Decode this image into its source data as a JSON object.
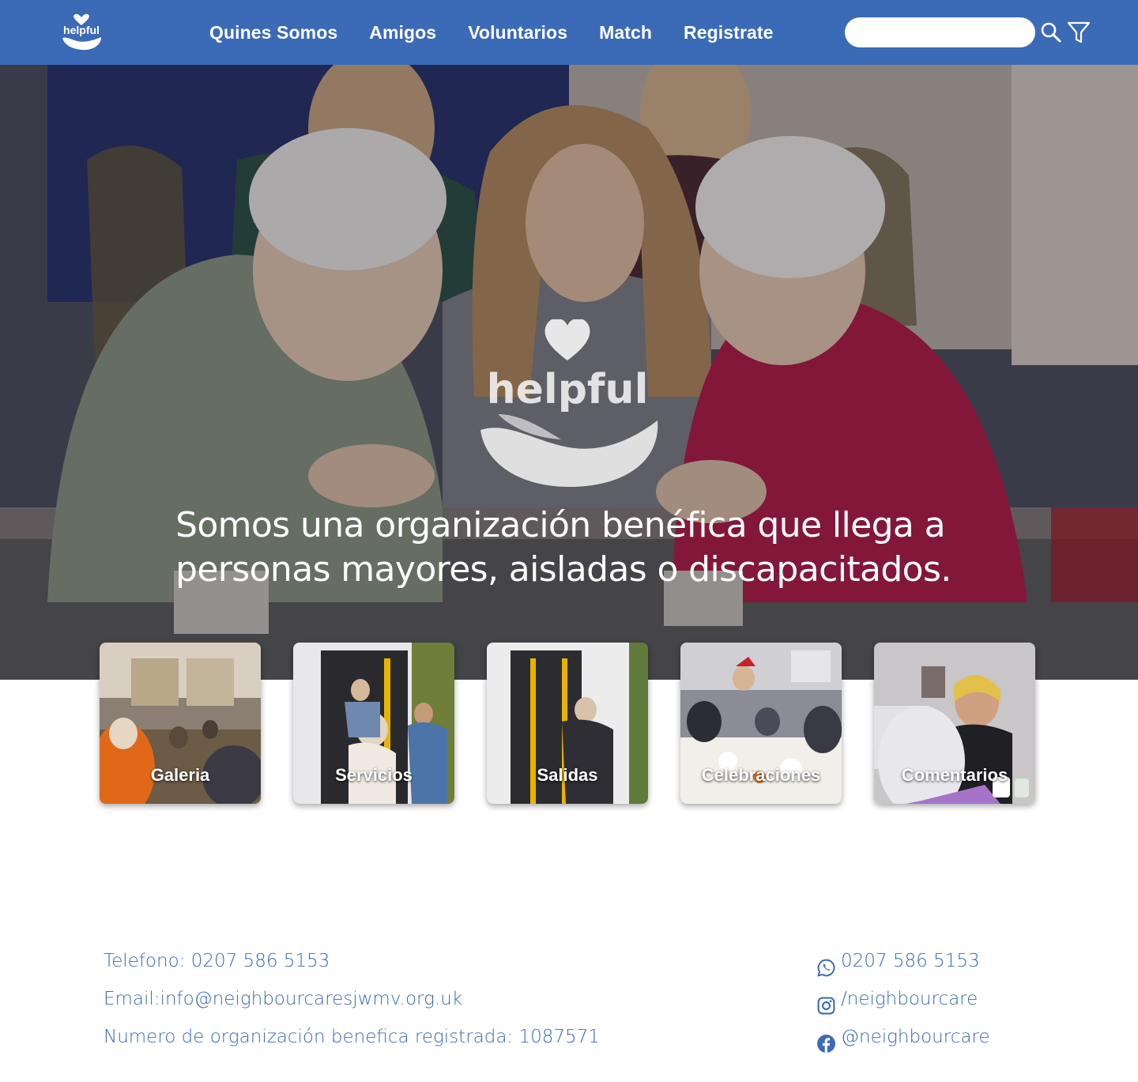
{
  "header": {
    "logo_text": "helpful",
    "nav": [
      {
        "label": "Quines Somos"
      },
      {
        "label": "Amigos"
      },
      {
        "label": "Voluntarios"
      },
      {
        "label": "Match"
      },
      {
        "label": "Registrate"
      }
    ],
    "search": {
      "value": "",
      "placeholder": ""
    },
    "icons": {
      "search": "search-icon",
      "filter": "filter-icon"
    },
    "colors": {
      "bar": "#3b6ab6",
      "text": "#ffffff"
    }
  },
  "hero": {
    "logo_text": "helpful",
    "tagline": "Somos una organización benéfica que llega a personas mayores, aisladas o discapacitados."
  },
  "cards": [
    {
      "label": "Galeria"
    },
    {
      "label": "Servicios"
    },
    {
      "label": "Salidas"
    },
    {
      "label": "Celebraciones"
    },
    {
      "label": "Comentarios"
    }
  ],
  "footer": {
    "left": [
      {
        "text": "Telefono: 0207 586 5153"
      },
      {
        "text": "Email:info@neighbourcaresjwmv.org.uk"
      },
      {
        "text": "Numero de organización benefica registrada: 1087571"
      }
    ],
    "right": [
      {
        "icon": "whatsapp-icon",
        "text": "0207 586 5153"
      },
      {
        "icon": "instagram-icon",
        "text": "/neighbourcare"
      },
      {
        "icon": "facebook-icon",
        "text": "@neighbourcare"
      }
    ],
    "color": "#3b6ab6"
  }
}
